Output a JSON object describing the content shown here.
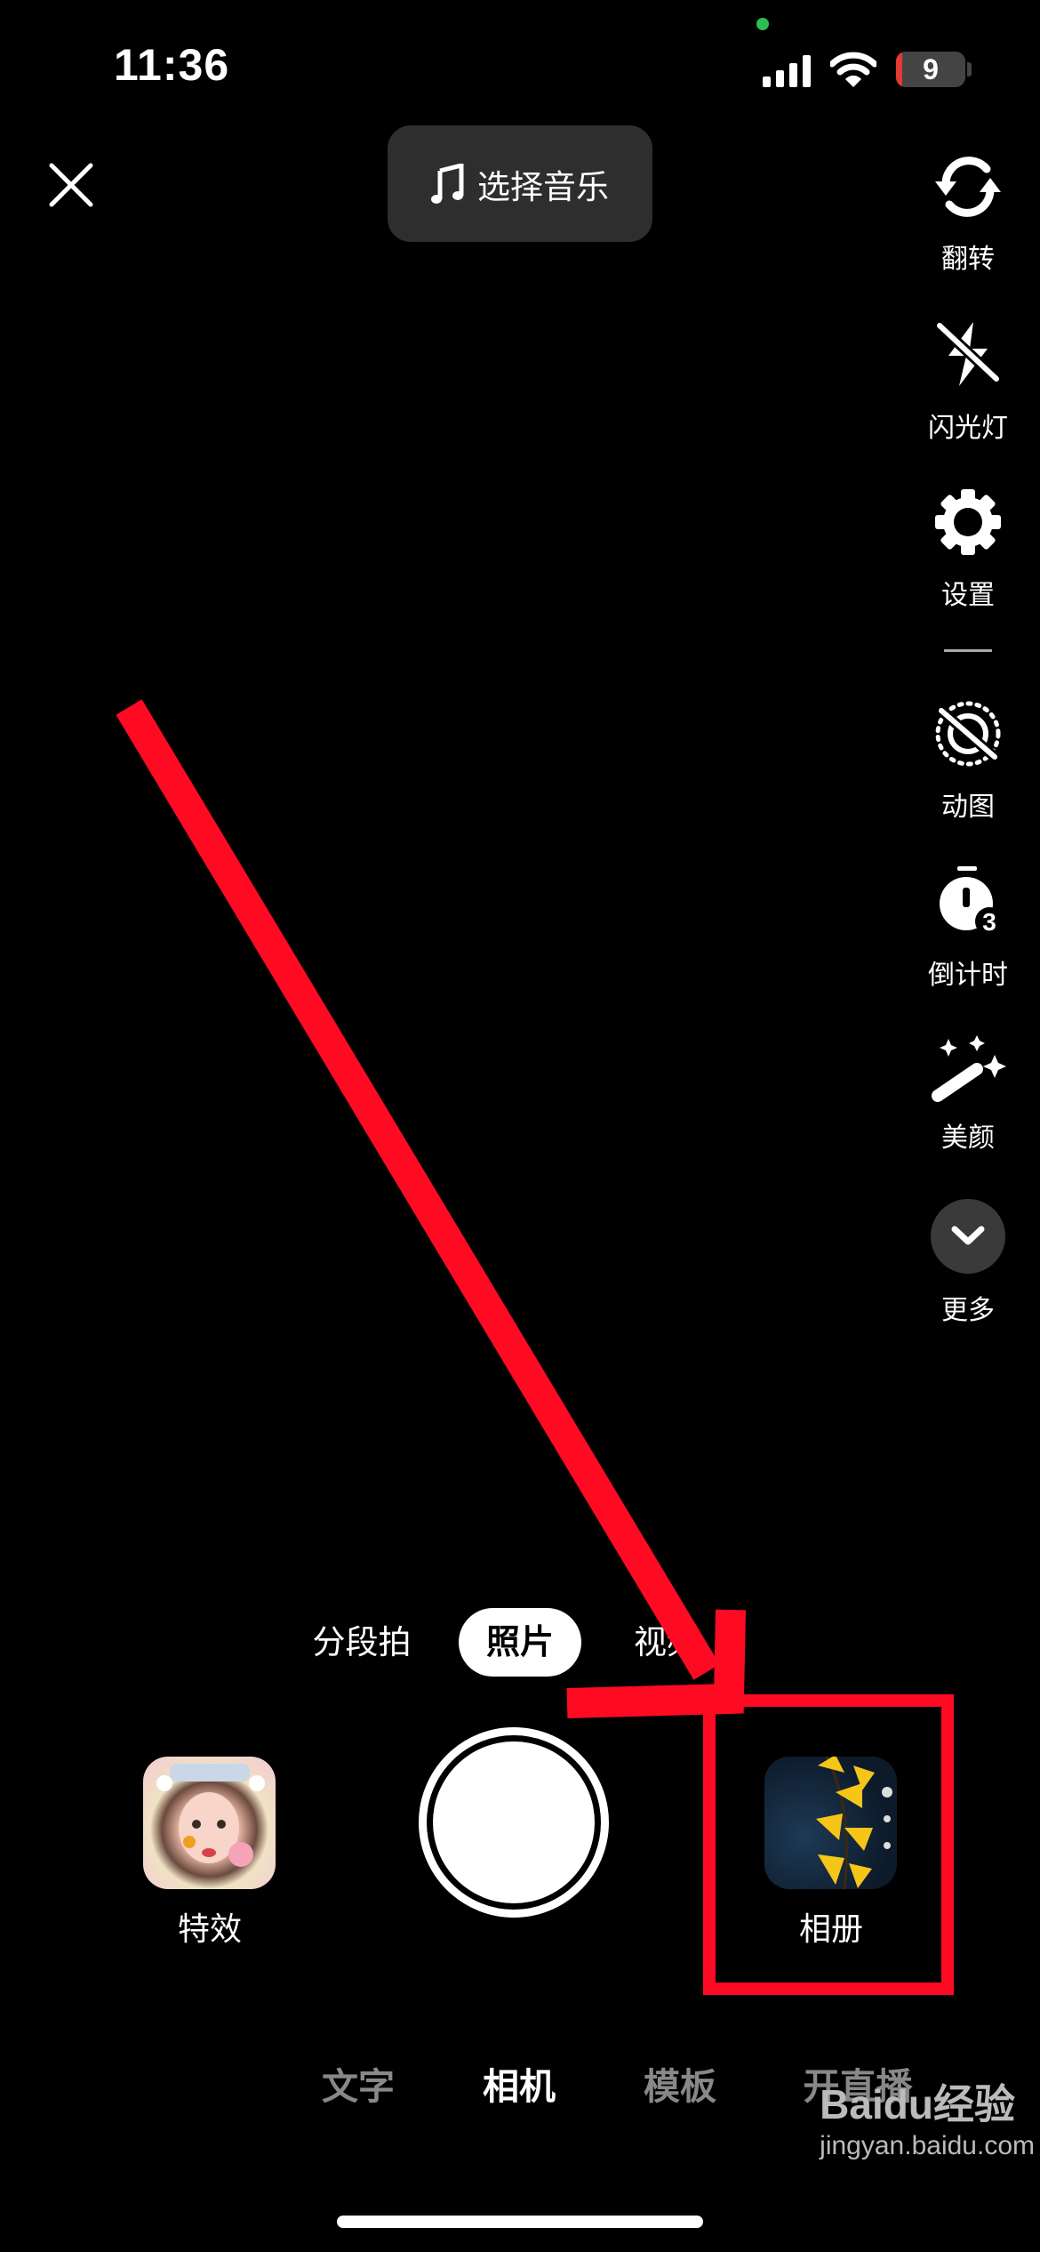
{
  "status_bar": {
    "time": "11:36",
    "battery": "9",
    "battery_low_color": "#e53935",
    "privacy_dot_color": "#2ebd4f"
  },
  "top": {
    "close_icon": "close-icon",
    "music_button": {
      "icon": "music-note-icon",
      "label": "选择音乐"
    }
  },
  "right_tools": [
    {
      "icon": "flip-camera-icon",
      "label": "翻转"
    },
    {
      "icon": "flash-off-icon",
      "label": "闪光灯"
    },
    {
      "icon": "gear-icon",
      "label": "设置"
    },
    {
      "icon": "live-photo-off-icon",
      "label": "动图"
    },
    {
      "icon": "timer-icon",
      "label": "倒计时",
      "badge": "3"
    },
    {
      "icon": "magic-wand-icon",
      "label": "美颜"
    },
    {
      "icon": "chevron-down-icon",
      "label": "更多"
    }
  ],
  "capture_modes": [
    {
      "label": "分段拍",
      "active": false
    },
    {
      "label": "照片",
      "active": true
    },
    {
      "label": "视频",
      "active": false
    }
  ],
  "effects": {
    "label": "特效"
  },
  "album": {
    "label": "相册"
  },
  "bottom_tabs": [
    {
      "label": "文字",
      "active": false
    },
    {
      "label": "相机",
      "active": true
    },
    {
      "label": "模板",
      "active": false
    },
    {
      "label": "开直播",
      "active": false
    }
  ],
  "annotation": {
    "color": "#ff0a23"
  },
  "watermark": {
    "brand": "Baidu经验",
    "url": "jingyan.baidu.com"
  }
}
